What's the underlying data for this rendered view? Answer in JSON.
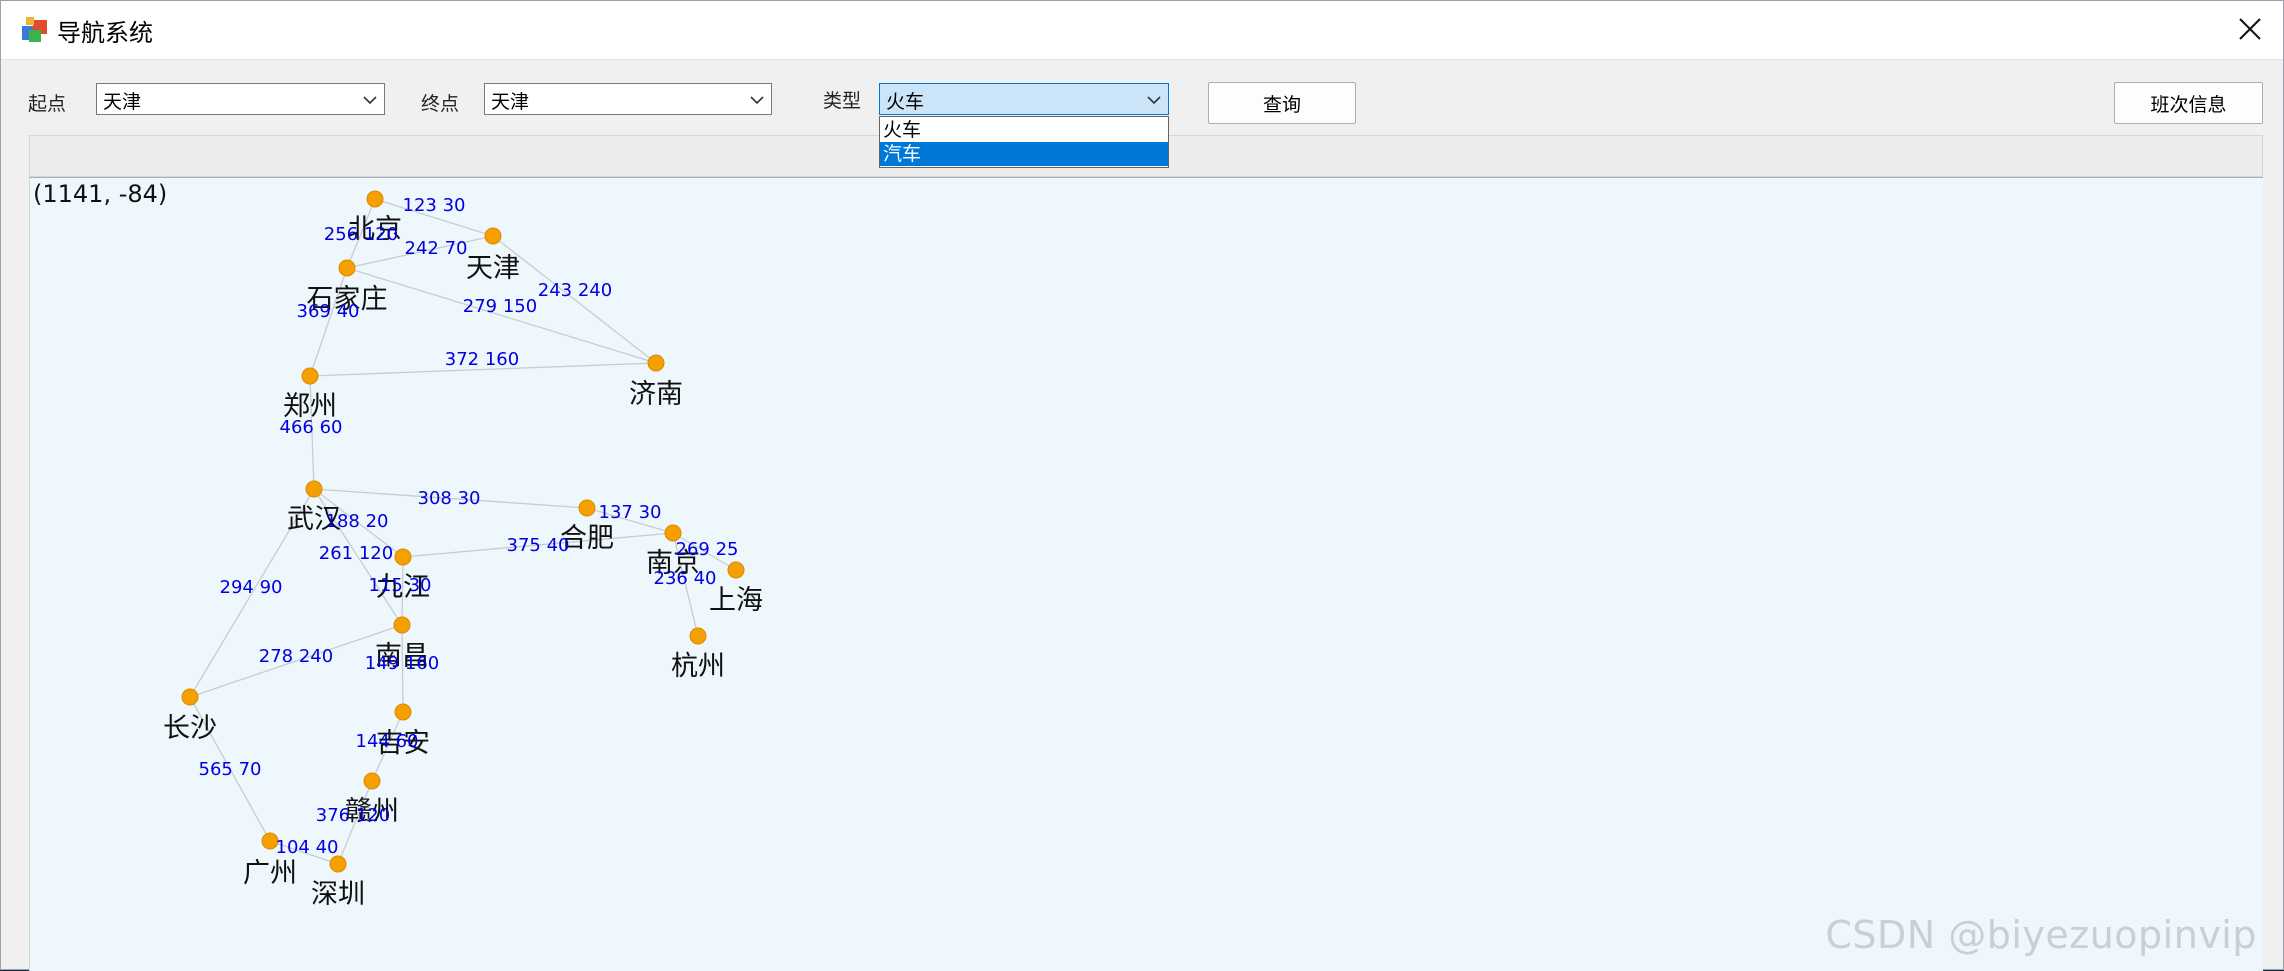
{
  "window": {
    "title": "导航系统"
  },
  "controls": {
    "start_label": "起点",
    "start_value": "天津",
    "end_label": "终点",
    "end_value": "天津",
    "type_label": "类型",
    "type_value": "火车",
    "type_options": [
      "火车",
      "汽车"
    ],
    "type_highlighted": "汽车",
    "query_button": "查询",
    "schedule_button": "班次信息"
  },
  "map": {
    "coordinate_readout": "(1141, -84)",
    "node_color": "#f5a000",
    "edge_color": "#c9ccd0",
    "edge_label_color": "#0000e0",
    "cities": [
      {
        "id": "beijing",
        "name": "北京"
      },
      {
        "id": "tianjin",
        "name": "天津"
      },
      {
        "id": "shijiazhuang",
        "name": "石家庄"
      },
      {
        "id": "jinan",
        "name": "济南"
      },
      {
        "id": "zhengzhou",
        "name": "郑州"
      },
      {
        "id": "wuhan",
        "name": "武汉"
      },
      {
        "id": "hefei",
        "name": "合肥"
      },
      {
        "id": "nanjing",
        "name": "南京"
      },
      {
        "id": "shanghai",
        "name": "上海"
      },
      {
        "id": "hangzhou",
        "name": "杭州"
      },
      {
        "id": "jiujiang",
        "name": "九江"
      },
      {
        "id": "nanchang",
        "name": "南昌"
      },
      {
        "id": "changsha",
        "name": "长沙"
      },
      {
        "id": "jian",
        "name": "吉安"
      },
      {
        "id": "ganzhou",
        "name": "赣州"
      },
      {
        "id": "guangzhou",
        "name": "广州"
      },
      {
        "id": "shenzhen",
        "name": "深圳"
      }
    ],
    "routes": [
      {
        "from": "beijing",
        "to": "tianjin",
        "label": "123  30"
      },
      {
        "from": "beijing",
        "to": "shijiazhuang",
        "label": "256  120"
      },
      {
        "from": "shijiazhuang",
        "to": "tianjin",
        "label": "242  70"
      },
      {
        "from": "tianjin",
        "to": "jinan",
        "label": "243  240"
      },
      {
        "from": "shijiazhuang",
        "to": "jinan",
        "label": "279  150"
      },
      {
        "from": "shijiazhuang",
        "to": "zhengzhou",
        "label": "369  40"
      },
      {
        "from": "zhengzhou",
        "to": "jinan",
        "label": "372  160"
      },
      {
        "from": "zhengzhou",
        "to": "wuhan",
        "label": "466  60"
      },
      {
        "from": "wuhan",
        "to": "hefei",
        "label": "308  30"
      },
      {
        "from": "hefei",
        "to": "nanjing",
        "label": "137  30"
      },
      {
        "from": "jiujiang",
        "to": "nanjing",
        "label": "375  40"
      },
      {
        "from": "nanjing",
        "to": "shanghai",
        "label": "269  25"
      },
      {
        "from": "nanjing",
        "to": "hangzhou",
        "label": "236  40"
      },
      {
        "from": "wuhan",
        "to": "jiujiang",
        "label": "188  20"
      },
      {
        "from": "wuhan",
        "to": "nanchang",
        "label": "261  120"
      },
      {
        "from": "jiujiang",
        "to": "nanchang",
        "label": "115  30"
      },
      {
        "from": "wuhan",
        "to": "changsha",
        "label": "294  90"
      },
      {
        "from": "changsha",
        "to": "nanchang",
        "label": "278  240"
      },
      {
        "from": "nanchang",
        "to": "jian",
        "label": "149  160"
      },
      {
        "from": "jian",
        "to": "ganzhou",
        "label": "144  60"
      },
      {
        "from": "changsha",
        "to": "guangzhou",
        "label": "565  70"
      },
      {
        "from": "ganzhou",
        "to": "shenzhen",
        "label": "376  120"
      },
      {
        "from": "guangzhou",
        "to": "shenzhen",
        "label": "104  40"
      }
    ]
  },
  "watermark": "CSDN @biyezuopinvip"
}
